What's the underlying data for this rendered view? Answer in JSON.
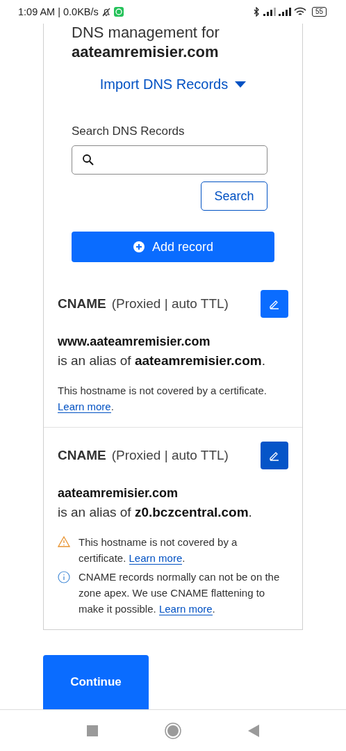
{
  "status_bar": {
    "time": "1:09 AM | 0.0KB/s",
    "battery": "55"
  },
  "header": {
    "title_line": "DNS management for",
    "domain": "aateamremisier.com"
  },
  "import_link": {
    "label": "Import DNS Records"
  },
  "search": {
    "label": "Search DNS Records",
    "button": "Search"
  },
  "add_button": {
    "label": "Add record"
  },
  "records": [
    {
      "type": "CNAME",
      "meta": "(Proxied | auto TTL)",
      "name": "www.aateamremisier.com",
      "alias": "is an alias of **aateamremisier.com**.",
      "edit_focused": false,
      "notes": [
        {
          "kind": "plain",
          "text": "This hostname is not covered by a certificate.",
          "link": "Learn more",
          "end": "."
        }
      ]
    },
    {
      "type": "CNAME",
      "meta": "(Proxied | auto TTL)",
      "name": "aateamremisier.com",
      "alias": "is an alias of **z0.bczcentral.com**.",
      "edit_focused": true,
      "notes": [
        {
          "kind": "warning",
          "text": "This hostname is not covered by a certificate.",
          "link": "Learn more",
          "end": "."
        },
        {
          "kind": "info",
          "text": "CNAME records normally can not be on the zone apex. We use CNAME flattening to make it possible.",
          "link": "Learn more",
          "end": "."
        }
      ]
    }
  ],
  "continue_button": {
    "label": "Continue"
  }
}
